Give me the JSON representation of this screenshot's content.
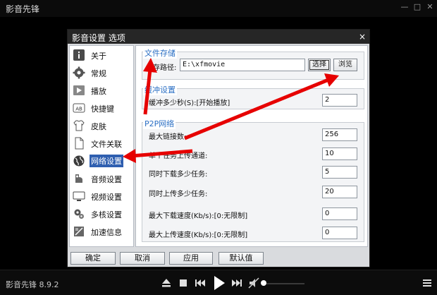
{
  "player": {
    "title": "影音先锋",
    "version": "影音先锋 8.9.2",
    "controls": {
      "minimize": "—",
      "maximize": "□",
      "close": "✕"
    }
  },
  "dialog": {
    "title": "影音设置 选项",
    "close": "×",
    "sidebar": [
      {
        "label": "关于",
        "icon": "info-icon"
      },
      {
        "label": "常规",
        "icon": "gear-icon"
      },
      {
        "label": "播放",
        "icon": "play-icon"
      },
      {
        "label": "快捷键",
        "icon": "keyboard-icon"
      },
      {
        "label": "皮肤",
        "icon": "shirt-icon"
      },
      {
        "label": "文件关联",
        "icon": "file-icon"
      },
      {
        "label": "网络设置",
        "icon": "globe-icon",
        "active": true
      },
      {
        "label": "音频设置",
        "icon": "speaker-icon"
      },
      {
        "label": "视频设置",
        "icon": "monitor-icon"
      },
      {
        "label": "多核设置",
        "icon": "cpu-gear-icon"
      },
      {
        "label": "加速信息",
        "icon": "chip-icon"
      }
    ],
    "storage": {
      "title": "文件存储",
      "label": "保存路径:",
      "path": "E:\\xfmovie",
      "select_button": "选择",
      "browse_button": "浏览"
    },
    "buffer": {
      "title": "缓冲设置",
      "label": "缓冲多少秒(S):[开始播放]",
      "value": "2"
    },
    "p2p": {
      "title": "P2P网络",
      "rows": [
        {
          "label": "最大链接数:",
          "value": "256"
        },
        {
          "label": "单个任务上传通道:",
          "value": "10"
        },
        {
          "label": "同时下载多少任务:",
          "value": "5"
        },
        {
          "label": "同时上传多少任务:",
          "value": "20"
        },
        {
          "label": "最大下载速度(Kb/s):[0:无限制]",
          "value": "0"
        },
        {
          "label": "最大上传速度(Kb/s):[0:无限制]",
          "value": "0"
        }
      ]
    },
    "footer": {
      "ok": "确定",
      "cancel": "取消",
      "apply": "应用",
      "default": "默认值"
    }
  },
  "colors": {
    "accent": "#2b6fc4",
    "active_item": "#2f5fb0",
    "arrow": "#e60000"
  }
}
